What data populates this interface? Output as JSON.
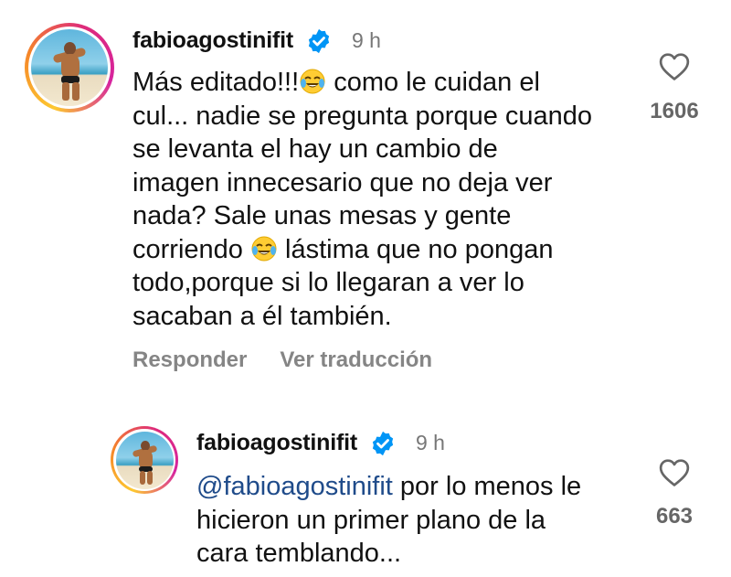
{
  "comments": [
    {
      "username": "fabioagostinifit",
      "time": "9 h",
      "text_lines": [
        "Más editado!!!",
        " como le cuidan el",
        "cul... nadie se pregunta porque cuando",
        "se levanta el hay un cambio de",
        "imagen innecesario que no deja ver",
        "nada? Sale unas mesas y gente",
        "corriendo ",
        " lástima que no pongan",
        "todo,porque si lo llegaran a ver lo",
        "sacaban a él también."
      ],
      "likes": "1606",
      "reply_label": "Responder",
      "translate_label": "Ver traducción"
    },
    {
      "username": "fabioagostinifit",
      "time": "9 h",
      "mention": "@fabioagostinifit",
      "text_lines": [
        " por lo menos le",
        "hicieron un primer plano de la",
        "cara temblando..."
      ],
      "likes": "663"
    }
  ],
  "icons": {
    "verified": "verified-badge-icon",
    "like": "heart-outline-icon",
    "emoji": "tears-of-joy-emoji-icon"
  },
  "colors": {
    "verified_blue": "#0095f6",
    "mention": "#1f4b8a",
    "muted_text": "#858585"
  }
}
